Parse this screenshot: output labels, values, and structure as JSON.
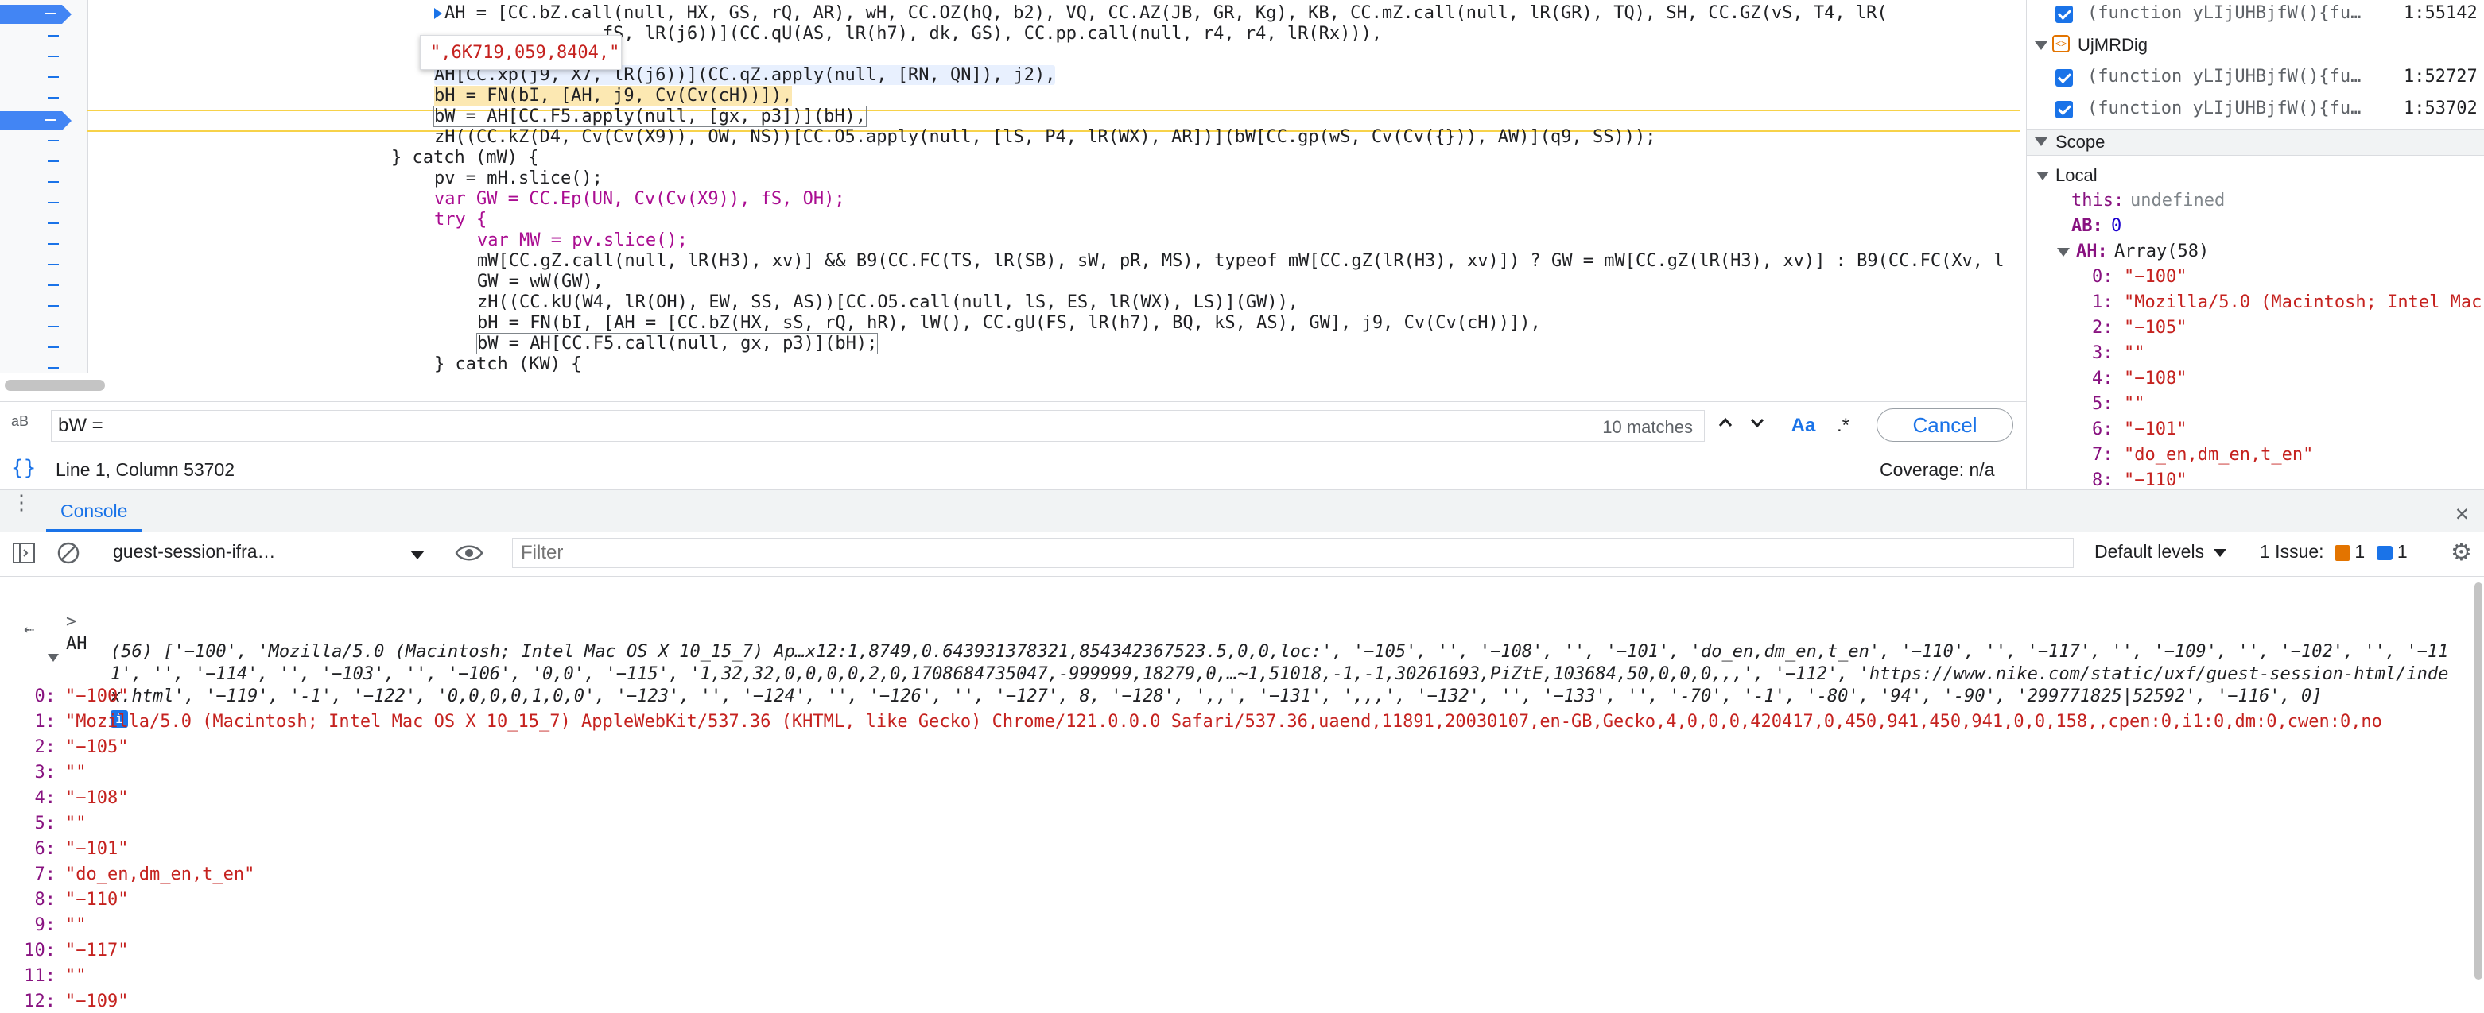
{
  "editor": {
    "tooltip": "\",6K719,059,8404,\"",
    "lines": [
      "AH = [CC.bZ.call(null, HX, GS, rQ, AR), wH, CC.OZ(hQ, b2), VQ, CC.AZ(JB, GR, Kg), KB, CC.mZ.call(null, lR(GR), TQ), SH, CC.GZ(vS, T4, lR(",
      "                fS, lR(j6))](CC.qU(AS, lR(h7), dk, GS), CC.pp.call(null, r4, r4, lR(Rx))),",
      "AH[CC.xp(j9, X7, lR(j6))](CC.qZ.apply(null, [RN, QN]), j2),",
      "bH = FN(bI, [AH, j9, Cv(Cv(cH))]),",
      "bW = AH[CC.F5.apply(null, [gx, p3])](bH),",
      "zH((CC.kZ(D4, Cv(Cv(X9)), OW, NS))[CC.O5.apply(null, [lS, P4, lR(WX), AR])](bW[CC.gp(wS, Cv(Cv({})), AW)](q9, SS)));",
      "} catch (mW) {",
      "pv = mH.slice();",
      "var GW = CC.Ep(UN, Cv(Cv(X9)), fS, OH);",
      "try {",
      "var MW = pv.slice();",
      "mW[CC.gZ.call(null, lR(H3), xv)] && B9(CC.FC(TS, lR(SB), sW, pR, MS), typeof mW[CC.gZ(lR(H3), xv)]) ? GW = mW[CC.gZ(lR(H3), xv)] : B9(CC.FC(Xv, l",
      "GW = wW(GW),",
      "zH((CC.kU(W4, lR(OH), EW, SS, AS))[CC.O5.call(null, lS, ES, lR(WX), LS)](GW)),",
      "bH = FN(bI, [AH = [CC.bZ(HX, sS, rQ, hR), lW(), CC.gU(FS, lR(h7), BQ, kS, AS), GW], j9, Cv(Cv(cH))]),",
      "bW = AH[CC.F5.call(null, gx, p3)](bH);",
      "} catch (KW) {"
    ]
  },
  "search": {
    "label": "aB",
    "value": "bW =",
    "matches": "10 matches",
    "case_toggle": "Aa",
    "regex_toggle": ".*",
    "cancel": "Cancel"
  },
  "status": {
    "position": "Line 1, Column 53702",
    "coverage": "Coverage: n/a"
  },
  "callstack": [
    {
      "label": "(function yLIjUHBjfW(){fu…",
      "line": "1:55142"
    },
    {
      "group": "UjMRDig"
    },
    {
      "label": "(function yLIjUHBjfW(){fu…",
      "line": "1:52727"
    },
    {
      "label": "(function yLIjUHBjfW(){fu…",
      "line": "1:53702"
    }
  ],
  "scope": {
    "title": "Scope",
    "local_title": "Local",
    "this_key": "this:",
    "this_value": "undefined",
    "ab_key": "AB:",
    "ab_value": "0",
    "ah_key": "AH:",
    "ah_value": "Array(58)",
    "items": [
      {
        "k": "0:",
        "v": "\"−100\""
      },
      {
        "k": "1:",
        "v": "\"Mozilla/5.0 (Macintosh; Intel Mac"
      },
      {
        "k": "2:",
        "v": "\"−105\""
      },
      {
        "k": "3:",
        "v": "\"\""
      },
      {
        "k": "4:",
        "v": "\"−108\""
      },
      {
        "k": "5:",
        "v": "\"\""
      },
      {
        "k": "6:",
        "v": "\"−101\""
      },
      {
        "k": "7:",
        "v": "\"do_en,dm_en,t_en\""
      },
      {
        "k": "8:",
        "v": "\"−110\""
      }
    ]
  },
  "console": {
    "tab": "Console",
    "context": "guest-session-ifra…",
    "filter_placeholder": "Filter",
    "levels": "Default levels",
    "issues_label": "1 Issue:",
    "issues_warn": "1",
    "issues_info": "1",
    "input_prompt": ">",
    "input": "AH",
    "result_line1": "(56) ['−100', 'Mozilla/5.0 (Macintosh; Intel Mac OS X 10_15_7) Ap…x12:1,8749,0.643931378321,854342367523.5,0,0,loc:', '−105', '', '−108', '', '−101', 'do_en,dm_en,t_en', '−110', '', '−117', '', '−109', '', '−102', '', '−11",
    "result_line2": "1', '', '−114', '', '−103', '', '−106', '0,0', '−115', '1,32,32,0,0,0,0,2,0,1708684735047,-999999,18279,0,…~1,51018,-1,-1,30261693,PiZtE,103684,50,0,0,0,,,', '−112', 'https://www.nike.com/static/uxf/guest-session-html/inde",
    "result_line3": "x.html', '−119', '-1', '−122', '0,0,0,0,1,0,0', '−123', '', '−124', '', '−126', '', '−127', 8, '−128', ',,', '−131', ',,,', '−132', '', '−133', '', '-70', '-1', '-80', '94', '-90', '299771825|52592', '−116', 0]",
    "entries": [
      {
        "k": "0:",
        "v": "\"−100\""
      },
      {
        "k": "1:",
        "v": "\"Mozilla/5.0 (Macintosh; Intel Mac OS X 10_15_7) AppleWebKit/537.36 (KHTML, like Gecko) Chrome/121.0.0.0 Safari/537.36,uaend,11891,20030107,en-GB,Gecko,4,0,0,0,420417,0,450,941,450,941,0,0,158,,cpen:0,i1:0,dm:0,cwen:0,no"
      },
      {
        "k": "2:",
        "v": "\"−105\""
      },
      {
        "k": "3:",
        "v": "\"\""
      },
      {
        "k": "4:",
        "v": "\"−108\""
      },
      {
        "k": "5:",
        "v": "\"\""
      },
      {
        "k": "6:",
        "v": "\"−101\""
      },
      {
        "k": "7:",
        "v": "\"do_en,dm_en,t_en\""
      },
      {
        "k": "8:",
        "v": "\"−110\""
      },
      {
        "k": "9:",
        "v": "\"\""
      },
      {
        "k": "10:",
        "v": "\"−117\""
      },
      {
        "k": "11:",
        "v": "\"\""
      },
      {
        "k": "12:",
        "v": "\"−109\""
      }
    ]
  },
  "colors": {
    "accent": "#1a73e8",
    "breakpoint": "#4285f4",
    "paused_line": "#f7d24a",
    "string": "#c5221f",
    "property": "#881280"
  }
}
